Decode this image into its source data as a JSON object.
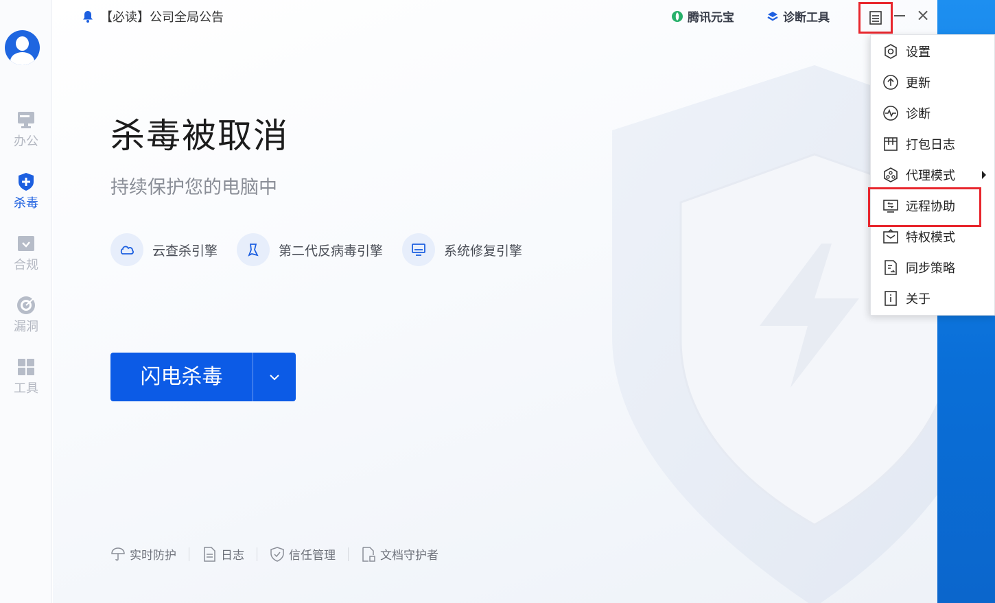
{
  "colors": {
    "accent": "#0c5be6",
    "sidebar_active": "#1c5fe0",
    "highlight": "#e8262d",
    "desktop_blue": "#1a7fe0"
  },
  "notice": {
    "icon": "bell-icon",
    "text": "【必读】公司全局公告"
  },
  "top_links": {
    "yuanbao": {
      "icon": "yuanbao-icon",
      "label": "腾讯元宝"
    },
    "diagnose": {
      "icon": "diagnose-tool-icon",
      "label": "诊断工具"
    }
  },
  "window_controls": {
    "menu": "menu-icon",
    "minimize": "minimize-icon",
    "close": "×"
  },
  "sidebar": {
    "items": [
      {
        "id": "office",
        "icon": "monitor-icon",
        "label": "办公",
        "active": false
      },
      {
        "id": "antivirus",
        "icon": "shield-plus-icon",
        "label": "杀毒",
        "active": true
      },
      {
        "id": "compliance",
        "icon": "compliance-icon",
        "label": "合规",
        "active": false
      },
      {
        "id": "vuln",
        "icon": "target-icon",
        "label": "漏洞",
        "active": false
      },
      {
        "id": "tools",
        "icon": "grid-icon",
        "label": "工具",
        "active": false
      }
    ]
  },
  "main": {
    "title": "杀毒被取消",
    "subtitle": "持续保护您的电脑中",
    "engines": [
      {
        "icon": "cloud-icon",
        "label": "云查杀引擎"
      },
      {
        "icon": "bug-icon",
        "label": "第二代反病毒引擎"
      },
      {
        "icon": "monitor-repair-icon",
        "label": "系统修复引擎"
      }
    ],
    "scan_button": {
      "label": "闪电杀毒",
      "dropdown_icon": "chevron-down-icon"
    },
    "footer": [
      {
        "icon": "umbrella-icon",
        "label": "实时防护"
      },
      {
        "icon": "document-icon",
        "label": "日志"
      },
      {
        "icon": "shield-check-icon",
        "label": "信任管理"
      },
      {
        "icon": "file-guard-icon",
        "label": "文档守护者"
      }
    ]
  },
  "dropdown": {
    "items": [
      {
        "icon": "settings-icon",
        "label": "设置",
        "submenu": false
      },
      {
        "icon": "update-icon",
        "label": "更新",
        "submenu": false
      },
      {
        "icon": "pulse-icon",
        "label": "诊断",
        "submenu": false
      },
      {
        "icon": "package-log-icon",
        "label": "打包日志",
        "submenu": false
      },
      {
        "icon": "proxy-icon",
        "label": "代理模式",
        "submenu": true
      },
      {
        "icon": "remote-assist-icon",
        "label": "远程协助",
        "submenu": false,
        "highlighted": true
      },
      {
        "icon": "privilege-icon",
        "label": "特权模式",
        "submenu": false
      },
      {
        "icon": "sync-policy-icon",
        "label": "同步策略",
        "submenu": false
      },
      {
        "icon": "about-icon",
        "label": "关于",
        "submenu": false
      }
    ]
  }
}
